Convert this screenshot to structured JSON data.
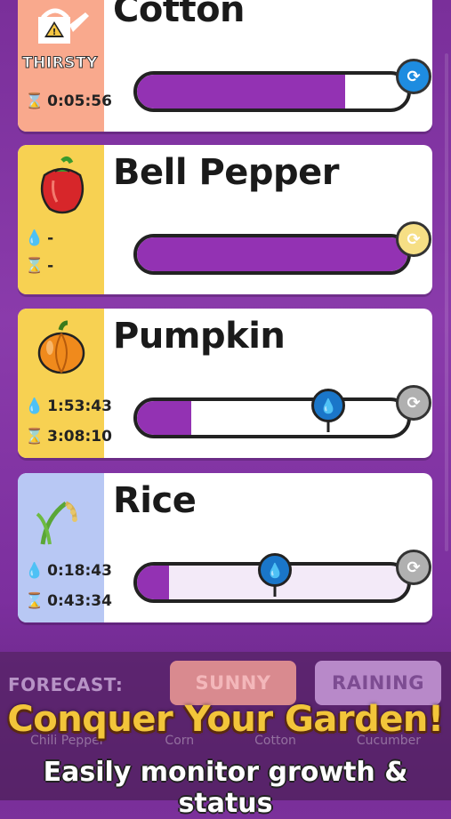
{
  "plants": [
    {
      "name": "Cotton",
      "status": "THIRSTY",
      "water_time": null,
      "grow_time": "0:05:56",
      "progress": 0.77,
      "side_color": "#f9a98d",
      "refresh_color": "#1e8ce0",
      "icon": "watering-can-warning-icon"
    },
    {
      "name": "Bell Pepper",
      "status": null,
      "water_time": "-",
      "grow_time": "-",
      "progress": 1.0,
      "side_color": "#f7d152",
      "refresh_color": "#f6df85",
      "icon": "bell-pepper-icon"
    },
    {
      "name": "Pumpkin",
      "status": null,
      "water_time": "1:53:43",
      "grow_time": "3:08:10",
      "progress": 0.2,
      "water_marker": 0.69,
      "side_color": "#f7d152",
      "refresh_color": "#b0b0b0",
      "icon": "pumpkin-icon"
    },
    {
      "name": "Rice",
      "status": null,
      "water_time": "0:18:43",
      "grow_time": "0:43:34",
      "progress": 0.12,
      "water_marker": 0.52,
      "side_color": "#b8c8f4",
      "refresh_color": "#b0b0b0",
      "icon": "rice-icon"
    }
  ],
  "forecast": {
    "label": "FORECAST:",
    "options": [
      "SUNNY",
      "RAINING"
    ]
  },
  "tabs": [
    "Chili Pepper",
    "Corn",
    "Cotton",
    "Cucumber"
  ],
  "promo": {
    "title": "Conquer Your Garden!",
    "subtitle": "Easily monitor growth & status"
  },
  "symbols": {
    "water": "💧",
    "hourglass": "⌛",
    "refresh": "⟳"
  }
}
